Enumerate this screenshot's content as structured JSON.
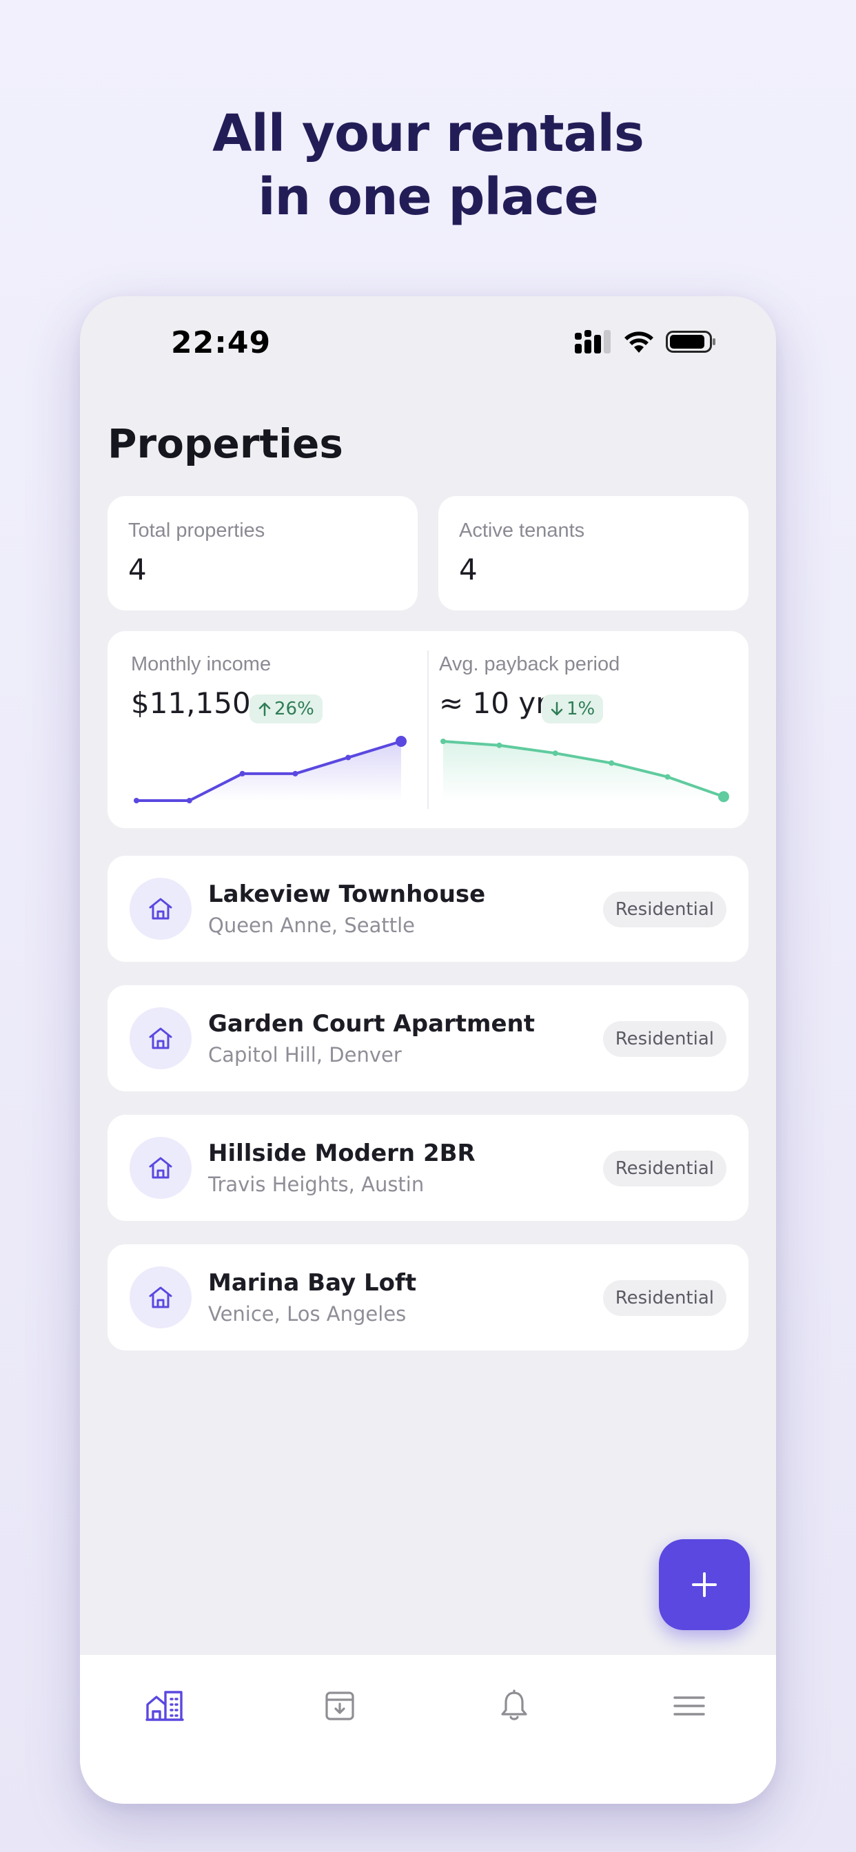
{
  "headline": {
    "line1": "All your rentals",
    "line2": "in one place"
  },
  "status_bar": {
    "time": "22:49"
  },
  "page_title": "Properties",
  "stats": [
    {
      "label": "Total properties",
      "value": "4"
    },
    {
      "label": "Active tenants",
      "value": "4"
    }
  ],
  "metrics": {
    "income": {
      "label": "Monthly income",
      "value": "$11,150",
      "badge": "26%",
      "trend": "up",
      "color": "#5a48e0"
    },
    "payback": {
      "label": "Avg. payback period",
      "value": "≈ 10 yr",
      "badge": "1%",
      "trend": "down",
      "color": "#5fcb9e"
    }
  },
  "chart_data": [
    {
      "type": "line",
      "title": "",
      "series": [
        {
          "values": [
            0,
            0,
            1,
            1,
            1.6,
            2.2
          ]
        }
      ]
    },
    {
      "type": "area",
      "title": "",
      "series": [
        {
          "values": [
            5,
            4.8,
            4.4,
            3.9,
            3.2,
            2.2
          ]
        }
      ]
    }
  ],
  "properties": [
    {
      "name": "Lakeview Townhouse",
      "location": "Queen Anne, Seattle",
      "tag": "Residential"
    },
    {
      "name": "Garden Court Apartment",
      "location": "Capitol Hill, Denver",
      "tag": "Residential"
    },
    {
      "name": "Hillside Modern 2BR",
      "location": "Travis Heights, Austin",
      "tag": "Residential"
    },
    {
      "name": "Marina Bay Loft",
      "location": "Venice, Los Angeles",
      "tag": "Residential"
    }
  ],
  "fab": {
    "icon": "plus-icon"
  },
  "tabs": [
    {
      "icon": "building-icon",
      "active": true
    },
    {
      "icon": "archive-icon",
      "active": false
    },
    {
      "icon": "bell-icon",
      "active": false
    },
    {
      "icon": "menu-icon",
      "active": false
    }
  ],
  "colors": {
    "accent": "#5a48e0",
    "headline": "#231d57",
    "positive": "#2e7d57"
  }
}
